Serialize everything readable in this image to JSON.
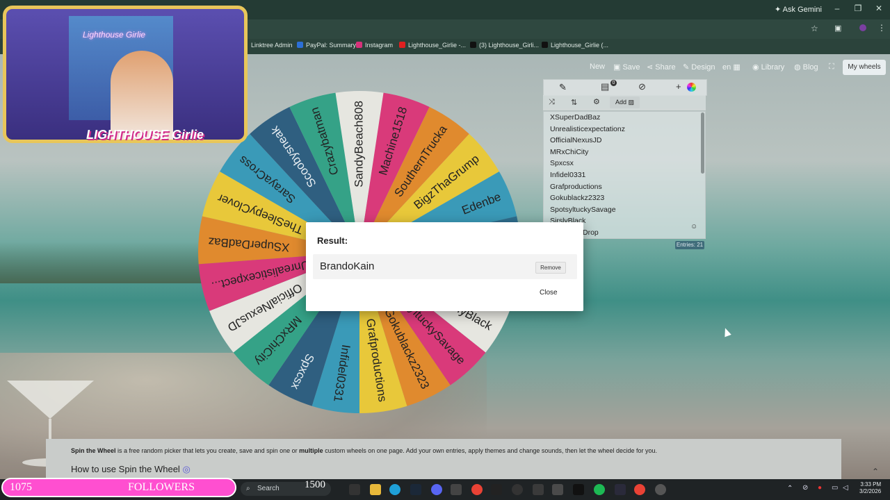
{
  "browser": {
    "gemini_label": "Ask Gemini",
    "bookmarks": [
      "Linktree Admin",
      "PayPal: Summary",
      "Instagram",
      "Lighthouse_Girlie -...",
      "(3) Lighthouse_Girli...",
      "Lighthouse_Girlie (..."
    ]
  },
  "toolbar": {
    "new": "New",
    "save": "Save",
    "share": "Share",
    "design": "Design",
    "lang": "en",
    "library": "Library",
    "blog": "Blog",
    "my_wheels": "My wheels"
  },
  "panel": {
    "add_label": "Add",
    "badge": "0",
    "entries": [
      "XSuperDadBaz",
      "Unrealisticexpectationz",
      "OfficialNexusJD",
      "MRxChiCity",
      "Spxcsx",
      "Infidel0331",
      "Grafproductions",
      "Gokublackz2323",
      "SpotsyltuckySavage",
      "SirslyBlack",
      "Drop"
    ],
    "entries_count": "Entries: 21"
  },
  "wheel": {
    "segments": [
      {
        "label": "SandyBeach808",
        "color": "#e6e6e0"
      },
      {
        "label": "Machine1518",
        "color": "#d93a7a"
      },
      {
        "label": "SouthernTrucka",
        "color": "#e08a2e"
      },
      {
        "label": "BigzThaGrump",
        "color": "#e8c83a"
      },
      {
        "label": "Edenbe",
        "color": "#3a9ab8"
      },
      {
        "label": "BrandoKain",
        "color": "#2f6f8f"
      },
      {
        "label": "Drop",
        "color": "#d93a7a"
      },
      {
        "label": "SirslyBlack",
        "color": "#e6e6e0"
      },
      {
        "label": "SpotsyltuckySavage",
        "color": "#d93a7a"
      },
      {
        "label": "Gokublackz2323",
        "color": "#e08a2e"
      },
      {
        "label": "Grafproductions",
        "color": "#e8c83a"
      },
      {
        "label": "Infidel0331",
        "color": "#3a9ab8"
      },
      {
        "label": "Spxcsx",
        "color": "#2f5f80"
      },
      {
        "label": "MRxChiCity",
        "color": "#35a287"
      },
      {
        "label": "OfficialNexusJD",
        "color": "#e6e6e0"
      },
      {
        "label": "Unrealisticexpect...",
        "color": "#d93a7a"
      },
      {
        "label": "XSuperDadBaz",
        "color": "#e08a2e"
      },
      {
        "label": "TheSleepyClover",
        "color": "#e8c83a"
      },
      {
        "label": "SarayaCross",
        "color": "#3a9ab8"
      },
      {
        "label": "Scoobysneak",
        "color": "#2f5f80"
      },
      {
        "label": "Crazybatman",
        "color": "#35a287"
      }
    ]
  },
  "dialog": {
    "title": "Result:",
    "result": "BrandoKain",
    "remove_label": "Remove",
    "close_label": "Close"
  },
  "footer": {
    "brand": "Spin the Wheel",
    "text_a": " is a free random picker that lets you create, save and spin one or ",
    "bold_b": "multiple",
    "text_c": " custom wheels on one page. Add your own entries, apply themes and change sounds, then let the wheel decide for you.",
    "howto": "How to use Spin the Wheel"
  },
  "overlay": {
    "cam_sign": "Lighthouse Girlie",
    "cam_logo": "LIGHTHOUSE Girlie",
    "followers_count": "1075",
    "followers_label": "FOLLOWERS",
    "goal": "1500"
  },
  "taskbar": {
    "search_placeholder": "Search",
    "time": "3:33 PM",
    "date": "3/2/2026"
  }
}
